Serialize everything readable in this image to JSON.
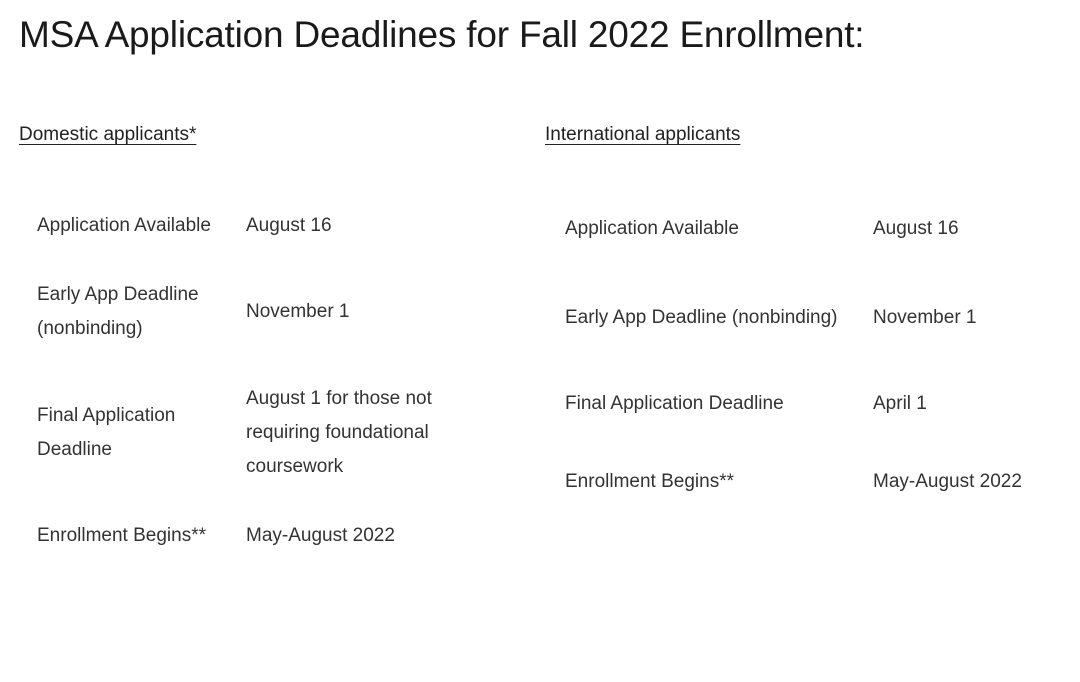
{
  "document": {
    "title": "MSA Application Deadlines for Fall 2022 Enrollment:",
    "text_color": "#333333",
    "title_color": "#1a1a1a",
    "background_color": "#ffffff"
  },
  "tables": {
    "domestic": {
      "header": "Domestic applicants*",
      "rows": [
        {
          "label": "Application Available",
          "value": "August 16"
        },
        {
          "label": "Early App Deadline (nonbinding)",
          "value": "November 1"
        },
        {
          "label": "Final Application Deadline",
          "value": "August 1 for those not requiring foundational coursework"
        },
        {
          "label": "Enrollment Begins**",
          "value": "May-August 2022"
        }
      ]
    },
    "international": {
      "header": "International applicants",
      "rows": [
        {
          "label": "Application Available",
          "value": "August 16"
        },
        {
          "label": "Early App Deadline (nonbinding)",
          "value": "November 1"
        },
        {
          "label": "Final Application Deadline",
          "value": "April 1"
        },
        {
          "label": "Enrollment Begins**",
          "value": "May-August 2022"
        }
      ]
    }
  }
}
